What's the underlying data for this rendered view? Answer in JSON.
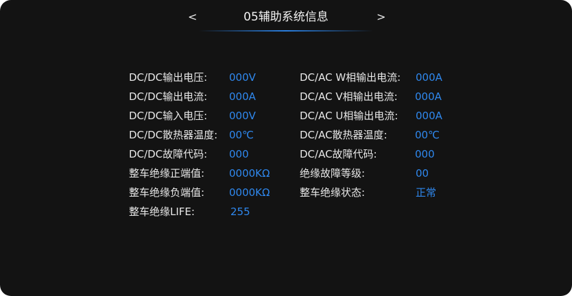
{
  "header": {
    "prev_label": "<",
    "next_label": ">",
    "title": "05辅助系统信息"
  },
  "left_column": [
    {
      "label": "DC/DC输出电压:",
      "value": "000V"
    },
    {
      "label": "DC/DC输出电流:",
      "value": "000A"
    },
    {
      "label": "DC/DC输入电压:",
      "value": "000V"
    },
    {
      "label": "DC/DC散热器温度:",
      "value": "00℃"
    },
    {
      "label": "DC/DC故障代码:",
      "value": "000"
    },
    {
      "label": "整车绝缘正端值:",
      "value": "0000KΩ"
    },
    {
      "label": "整车绝缘负端值:",
      "value": "0000KΩ"
    },
    {
      "label": "整车绝缘LIFE:",
      "value": "255"
    }
  ],
  "right_column": [
    {
      "label": "DC/AC W相输出电流:",
      "value": "000A"
    },
    {
      "label": "DC/AC V相输出电流:",
      "value": "000A"
    },
    {
      "label": "DC/AC U相输出电流:",
      "value": "000A"
    },
    {
      "label": "DC/AC散热器温度:",
      "value": "00℃"
    },
    {
      "label": "DC/AC故障代码:",
      "value": "000"
    },
    {
      "label": "绝缘故障等级:",
      "value": "00"
    },
    {
      "label": "整车绝缘状态:",
      "value": "正常"
    }
  ],
  "colors": {
    "background": "#131313",
    "label": "#e8e8e8",
    "value": "#2f88ee",
    "accent_line": "#2a7fe0"
  }
}
